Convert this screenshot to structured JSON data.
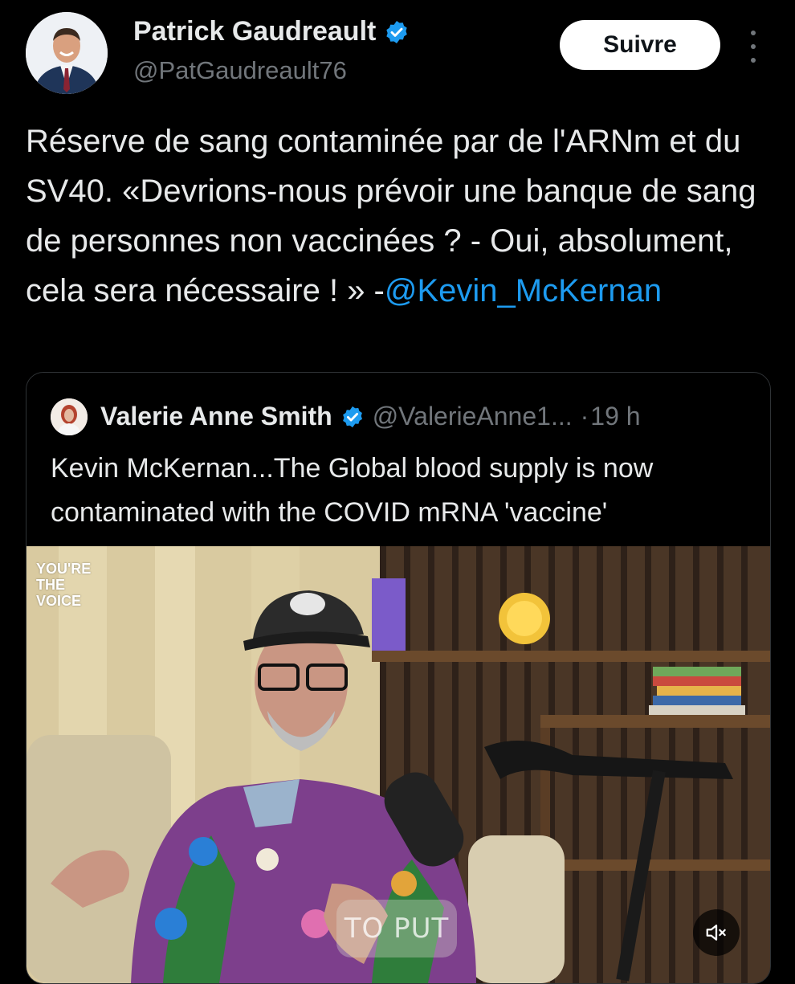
{
  "tweet": {
    "author_name": "Patrick Gaudreault",
    "author_handle": "@PatGaudreault76",
    "follow_label": "Suivre",
    "text_body": "Réserve de sang contaminée par de l'ARNm et du SV40. «Devrions-nous prévoir une banque de sang de personnes non vaccinées ? - Oui, absolument, cela sera nécessaire ! » -",
    "mention": "@Kevin_McKernan"
  },
  "quote": {
    "author_name": "Valerie Anne Smith",
    "author_handle": "@ValerieAnne1...",
    "separator": "·",
    "time": "19 h",
    "text": "Kevin McKernan...The Global blood supply is now contaminated with the COVID mRNA 'vaccine'",
    "video": {
      "overlay_logo": "YOU'RE\nTHE\nVOICE",
      "caption": "TO PUT"
    }
  },
  "icons": {
    "verified": "verified-badge-icon",
    "more": "more-vertical-icon",
    "mute": "speaker-muted-icon"
  },
  "colors": {
    "background": "#000000",
    "text": "#e7e9ea",
    "secondary": "#71767b",
    "link": "#1d9bf0",
    "verified": "#1d9bf0"
  }
}
